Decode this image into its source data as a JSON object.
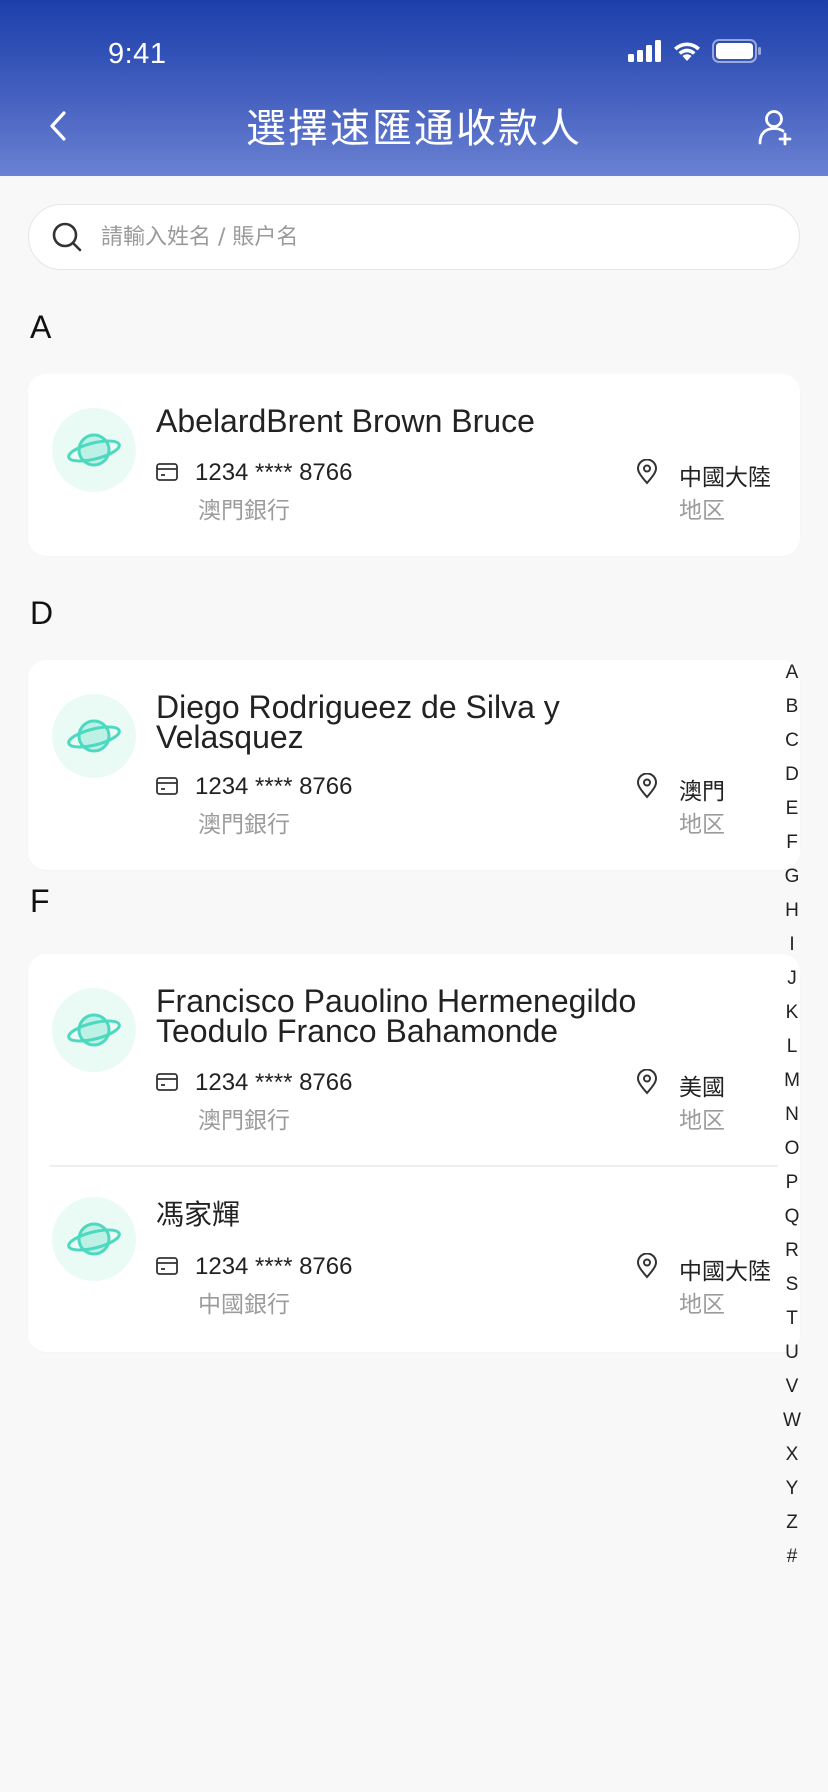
{
  "status_bar": {
    "time": "9:41"
  },
  "nav": {
    "title": "選擇速匯通收款人"
  },
  "search": {
    "placeholder": "請輸入姓名 / 賬户名"
  },
  "sections": [
    {
      "letter": "A",
      "payees": [
        {
          "name": "AbelardBrent Brown Bruce",
          "account": "1234 **** 8766",
          "bank": "澳門銀行",
          "region": "中國大陸",
          "region_label": "地区"
        }
      ]
    },
    {
      "letter": "D",
      "payees": [
        {
          "name": "Diego Rodrigueez de Silva y Velasquez",
          "account": "1234 **** 8766",
          "bank": "澳門銀行",
          "region": "澳門",
          "region_label": "地区"
        }
      ]
    },
    {
      "letter": "F",
      "payees": [
        {
          "name": "Francisco Pauolino Hermenegildo Teodulo Franco Bahamonde",
          "account": "1234 **** 8766",
          "bank": "澳門銀行",
          "region": "美國",
          "region_label": "地区"
        },
        {
          "name": "馮家輝",
          "account": "1234 **** 8766",
          "bank": "中國銀行",
          "region": "中國大陸",
          "region_label": "地区"
        }
      ]
    }
  ],
  "index_letters": [
    "A",
    "B",
    "C",
    "D",
    "E",
    "F",
    "G",
    "H",
    "I",
    "J",
    "K",
    "L",
    "M",
    "N",
    "O",
    "P",
    "Q",
    "R",
    "S",
    "T",
    "U",
    "V",
    "W",
    "X",
    "Y",
    "Z",
    "#"
  ],
  "colors": {
    "header_top": "#1b3faa",
    "header_bottom": "#6a82d2",
    "avatar_bg": "#eafbf6",
    "planet": "#4dd8c0"
  },
  "icons": {
    "back": "chevron-left-icon",
    "add_user": "add-user-icon",
    "search": "search-icon",
    "account": "card-icon",
    "region": "location-pin-icon",
    "avatar": "planet-icon"
  }
}
